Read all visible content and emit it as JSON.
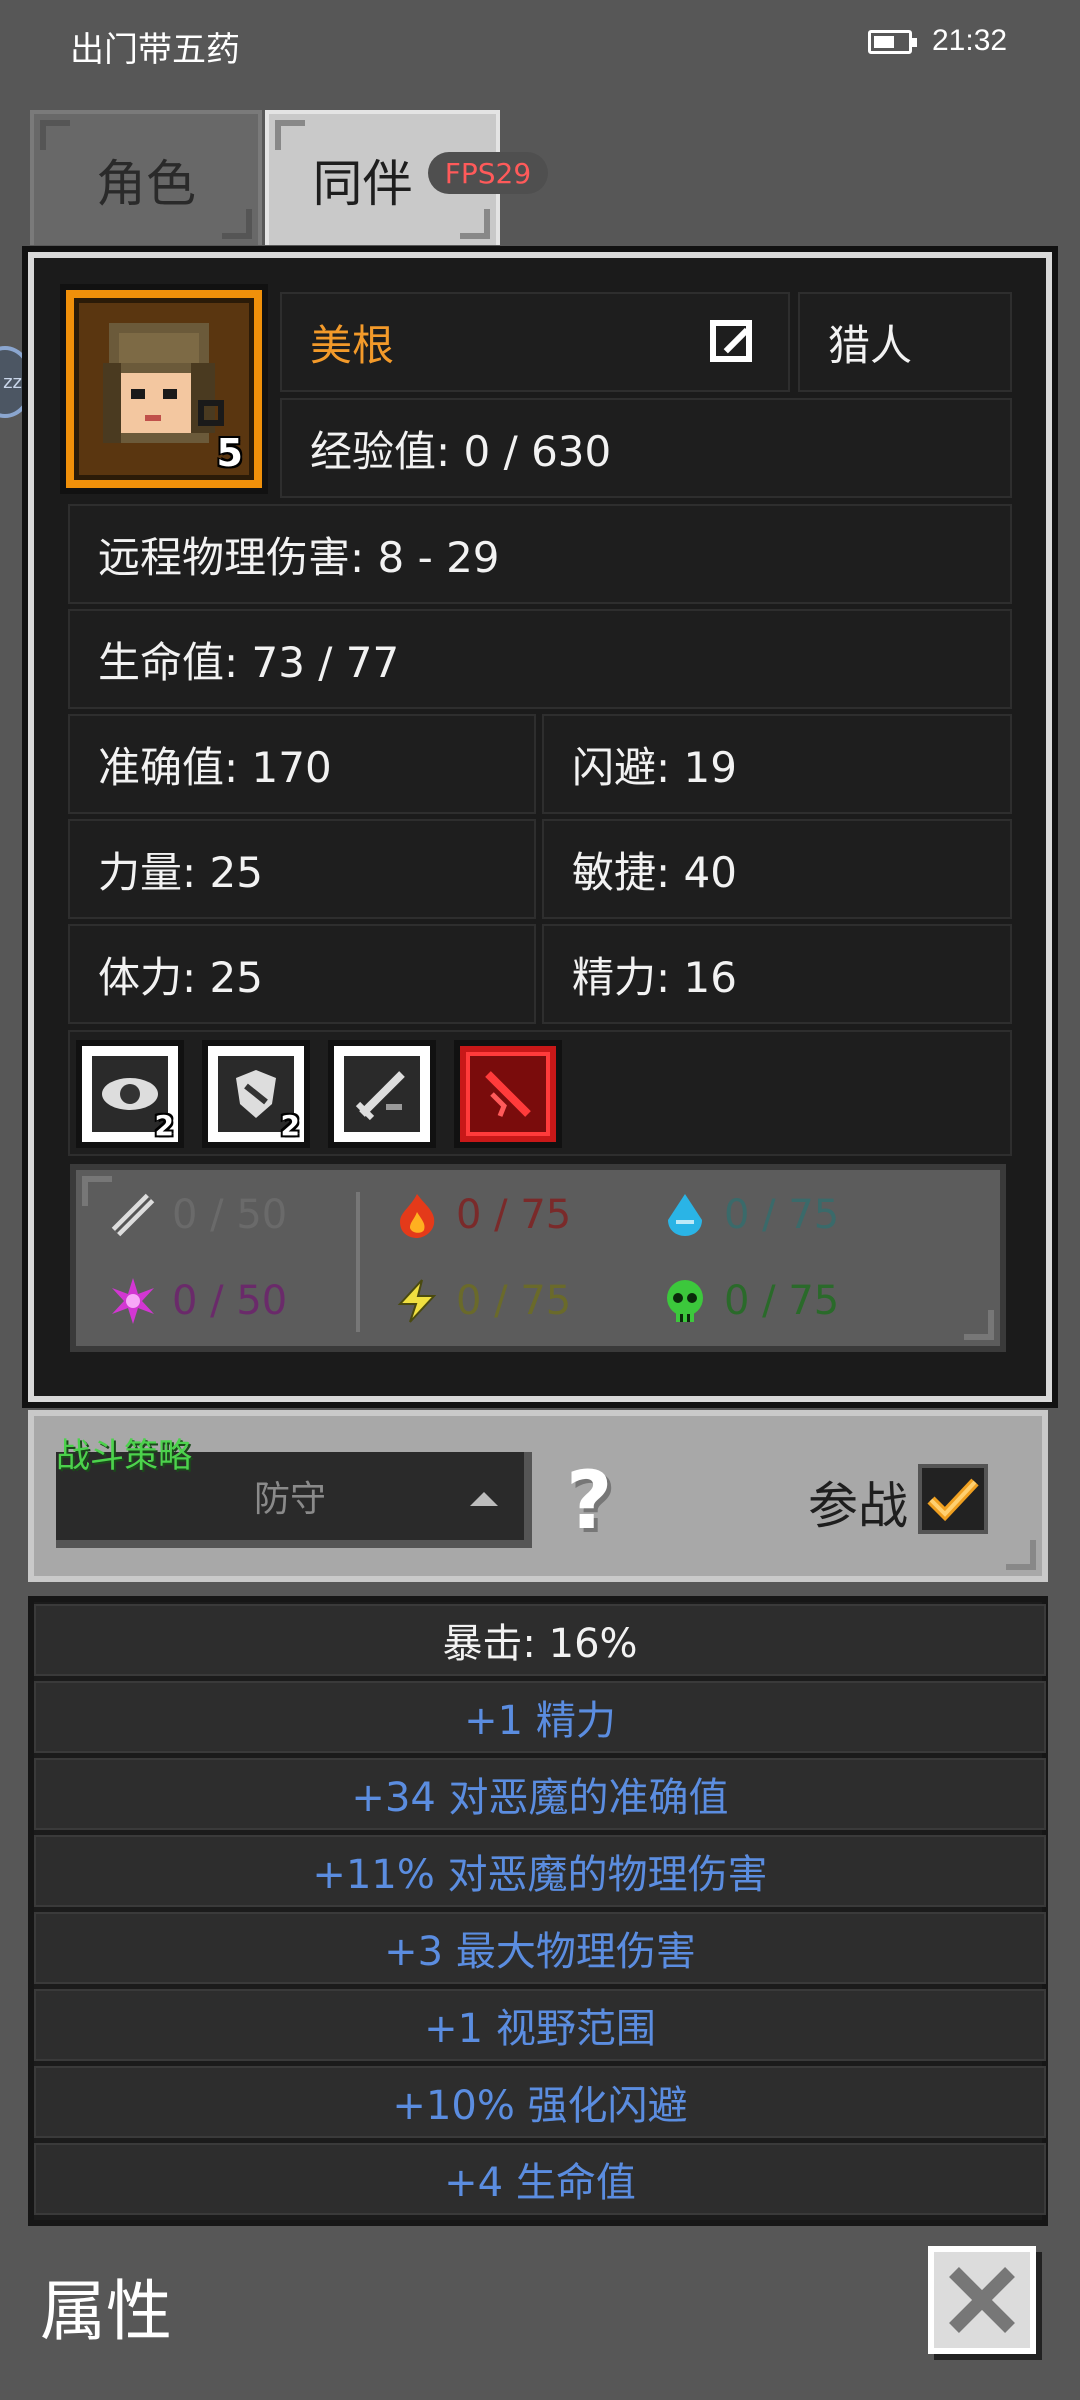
{
  "status_bar": {
    "app_name": "出门带五药",
    "time": "21:32"
  },
  "tabs": [
    {
      "label": "角色",
      "active": false
    },
    {
      "label": "同伴",
      "active": true
    }
  ],
  "fps_badge": "FPS29",
  "side_ball": "zz",
  "companion": {
    "name": "美根",
    "class": "猎人",
    "level": "5",
    "experience": "经验值: 0 / 630",
    "ranged_damage": "远程物理伤害: 8 - 29",
    "hp": "生命值: 73 / 77",
    "accuracy": "准确值: 170",
    "dodge": "闪避: 19",
    "strength": "力量: 25",
    "agility": "敏捷: 40",
    "stamina": "体力: 25",
    "energy": "精力: 16"
  },
  "skills": [
    {
      "icon": "eye-skill-icon",
      "count": "2"
    },
    {
      "icon": "shield-skill-icon",
      "count": "2"
    },
    {
      "icon": "sword-skill-icon",
      "count": ""
    },
    {
      "icon": "red-dagger-skill-icon",
      "count": ""
    }
  ],
  "resistances": [
    {
      "icon": "physical-resist-icon",
      "value": "0 / 50",
      "color": "#6a6a6a"
    },
    {
      "icon": "fire-resist-icon",
      "value": "0 / 75",
      "color": "#7a2a2a"
    },
    {
      "icon": "water-resist-icon",
      "value": "0 / 75",
      "color": "#3a6a6a"
    },
    {
      "icon": "arcane-resist-icon",
      "value": "0 / 50",
      "color": "#6a2a6a"
    },
    {
      "icon": "lightning-resist-icon",
      "value": "0 / 75",
      "color": "#6a6a2a"
    },
    {
      "icon": "poison-resist-icon",
      "value": "0 / 75",
      "color": "#2a6a2a"
    }
  ],
  "strategy": {
    "title": "战斗策略",
    "selected": "防守",
    "help": "?",
    "join_label": "参战",
    "join_checked": true
  },
  "attributes": [
    "暴击: 16%",
    "+1 精力",
    "+34 对恶魔的准确值",
    "+11% 对恶魔的物理伤害",
    "+3 最大物理伤害",
    "+1 视野范围",
    "+10% 强化闪避",
    "+4 生命值"
  ],
  "bottom": {
    "title": "属性"
  }
}
